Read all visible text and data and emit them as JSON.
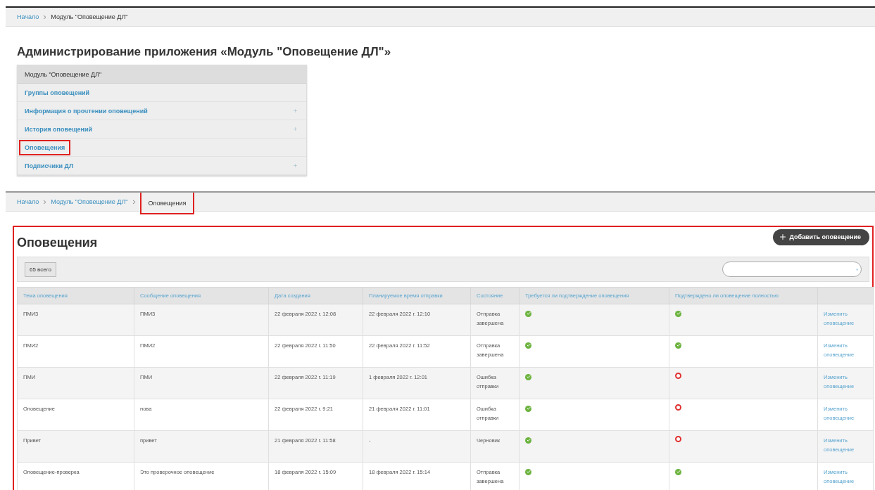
{
  "top_breadcrumb": [
    {
      "label": "Начало",
      "link": true,
      "highlighted": false
    },
    {
      "label": "Модуль \"Оповещение ДЛ\"",
      "link": false,
      "highlighted": false
    }
  ],
  "title": "Администрирование приложения «Модуль \"Оповещение ДЛ\"»",
  "menu": {
    "header": "Модуль \"Оповещение ДЛ\"",
    "items": [
      {
        "label": "Группы оповещений",
        "expandable": false,
        "highlighted": false
      },
      {
        "label": "Информация о прочтении оповещений",
        "expandable": true,
        "highlighted": false
      },
      {
        "label": "История оповещений",
        "expandable": true,
        "highlighted": false
      },
      {
        "label": "Оповещения",
        "expandable": false,
        "highlighted": true
      },
      {
        "label": "Подписчики ДЛ",
        "expandable": true,
        "highlighted": false
      }
    ]
  },
  "breadcrumb": [
    {
      "label": "Начало",
      "link": true,
      "highlighted": false
    },
    {
      "label": "Модуль \"Оповещение ДЛ\"",
      "link": true,
      "highlighted": false
    },
    {
      "label": "Оповещения",
      "link": false,
      "highlighted": true
    }
  ],
  "panel": {
    "title": "Оповещения",
    "highlighted": true,
    "add_button": "Добавить оповещение",
    "count": "65 всего",
    "columns": [
      "Тема оповещения",
      "Сообщение оповещения",
      "Дата создания",
      "Планируемое время отправки",
      "Состояние",
      "Требуется ли подтверждение оповещения",
      "Подтверждено ли оповещение полностью"
    ],
    "rows": [
      {
        "topic": "ПМИ3",
        "message": "ПМИ3",
        "created": "22 февраля 2022 г. 12:08",
        "planned": "22 февраля 2022 г. 12:10",
        "state": "Отправка завершена",
        "confirmation_required": true,
        "confirmed": true,
        "edit": "Изменить оповещение"
      },
      {
        "topic": "ПМИ2",
        "message": "ПМИ2",
        "created": "22 февраля 2022 г. 11:50",
        "planned": "22 февраля 2022 г. 11:52",
        "state": "Отправка завершена",
        "confirmation_required": true,
        "confirmed": true,
        "edit": "Изменить оповещение"
      },
      {
        "topic": "ПМИ",
        "message": "ПМИ",
        "created": "22 февраля 2022 г. 11:19",
        "planned": "1 февраля 2022 г. 12:01",
        "state": "Ошибка отправки",
        "confirmation_required": true,
        "confirmed": false,
        "edit": "Изменить оповещение"
      },
      {
        "topic": "Оповещение",
        "message": "нова",
        "created": "22 февраля 2022 г. 9:21",
        "planned": "21 февраля 2022 г. 11:01",
        "state": "Ошибка отправки",
        "confirmation_required": true,
        "confirmed": false,
        "edit": "Изменить оповещение"
      },
      {
        "topic": "Привет",
        "message": "привет",
        "created": "21 февраля 2022 г. 11:58",
        "planned": "-",
        "state": "Черновик",
        "confirmation_required": true,
        "confirmed": false,
        "edit": "Изменить оповещение"
      },
      {
        "topic": "Оповещение-проверка",
        "message": "Это проверочное оповещение",
        "created": "18 февраля 2022 г. 15:09",
        "planned": "18 февраля 2022 г. 15:14",
        "state": "Отправка завершена",
        "confirmation_required": true,
        "confirmed": true,
        "edit": "Изменить оповещение"
      }
    ]
  }
}
